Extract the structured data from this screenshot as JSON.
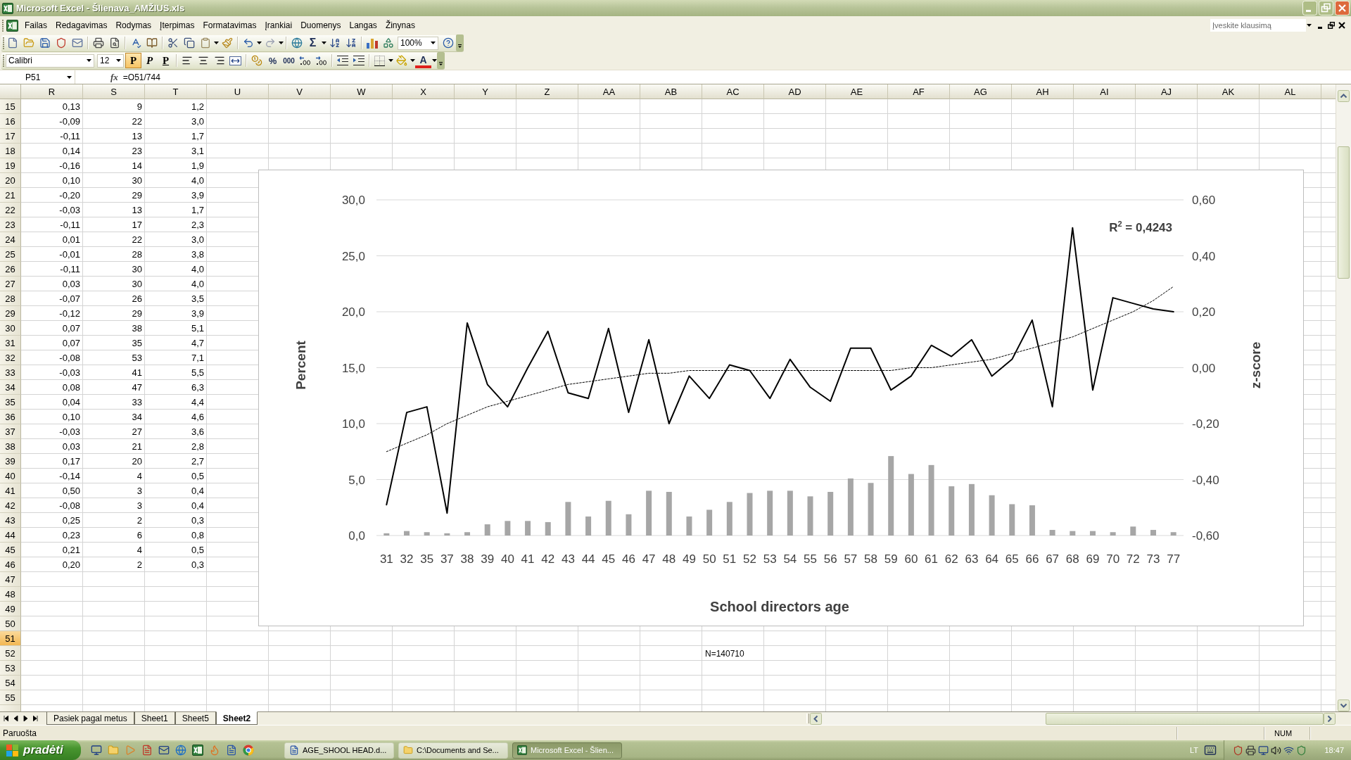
{
  "window": {
    "title": "Microsoft Excel - Šlienava_AMŽIUS.xls"
  },
  "menu": {
    "items": [
      "Failas",
      "Redagavimas",
      "Rodymas",
      "Įterpimas",
      "Formatavimas",
      "Įrankiai",
      "Duomenys",
      "Langas",
      "Žinynas"
    ],
    "help_box": {
      "placeholder": "Įveskite klausimą"
    }
  },
  "standard_toolbar": {
    "autosum": "Σ",
    "zoom": "100%"
  },
  "formatting_toolbar": {
    "font": "Calibri",
    "size": "12",
    "styles": [
      {
        "kind": "bold",
        "label": "P",
        "selected": true
      },
      {
        "kind": "italic",
        "label": "P",
        "selected": false
      },
      {
        "kind": "underline",
        "label": "P",
        "selected": false
      }
    ],
    "percent": "%",
    "thousands": "000",
    "font_color": "A"
  },
  "formula_bar": {
    "name_box": "P51",
    "fx": "fx",
    "formula": "=O51/744"
  },
  "sheet": {
    "columns": [
      {
        "label": "R",
        "selected": false
      },
      {
        "label": "S",
        "selected": false
      },
      {
        "label": "T",
        "selected": false
      },
      {
        "label": "U",
        "selected": false
      },
      {
        "label": "V",
        "selected": false
      },
      {
        "label": "W",
        "selected": false
      },
      {
        "label": "X",
        "selected": false
      },
      {
        "label": "Y",
        "selected": false
      },
      {
        "label": "Z",
        "selected": false
      },
      {
        "label": "AA",
        "selected": false
      },
      {
        "label": "AB",
        "selected": false
      },
      {
        "label": "AC",
        "selected": false
      },
      {
        "label": "AD",
        "selected": false
      },
      {
        "label": "AE",
        "selected": false
      },
      {
        "label": "AF",
        "selected": false
      },
      {
        "label": "AG",
        "selected": false
      },
      {
        "label": "AH",
        "selected": false
      },
      {
        "label": "AI",
        "selected": false
      },
      {
        "label": "AJ",
        "selected": false
      },
      {
        "label": "AK",
        "selected": false
      },
      {
        "label": "AL",
        "selected": false
      }
    ],
    "rows": [
      {
        "label": "15",
        "selected": false,
        "values": [
          "0,13",
          "9",
          "1,2"
        ]
      },
      {
        "label": "16",
        "selected": false,
        "values": [
          "-0,09",
          "22",
          "3,0"
        ]
      },
      {
        "label": "17",
        "selected": false,
        "values": [
          "-0,11",
          "13",
          "1,7"
        ]
      },
      {
        "label": "18",
        "selected": false,
        "values": [
          "0,14",
          "23",
          "3,1"
        ]
      },
      {
        "label": "19",
        "selected": false,
        "values": [
          "-0,16",
          "14",
          "1,9"
        ]
      },
      {
        "label": "20",
        "selected": false,
        "values": [
          "0,10",
          "30",
          "4,0"
        ]
      },
      {
        "label": "21",
        "selected": false,
        "values": [
          "-0,20",
          "29",
          "3,9"
        ]
      },
      {
        "label": "22",
        "selected": false,
        "values": [
          "-0,03",
          "13",
          "1,7"
        ]
      },
      {
        "label": "23",
        "selected": false,
        "values": [
          "-0,11",
          "17",
          "2,3"
        ]
      },
      {
        "label": "24",
        "selected": false,
        "values": [
          "0,01",
          "22",
          "3,0"
        ]
      },
      {
        "label": "25",
        "selected": false,
        "values": [
          "-0,01",
          "28",
          "3,8"
        ]
      },
      {
        "label": "26",
        "selected": false,
        "values": [
          "-0,11",
          "30",
          "4,0"
        ]
      },
      {
        "label": "27",
        "selected": false,
        "values": [
          "0,03",
          "30",
          "4,0"
        ]
      },
      {
        "label": "28",
        "selected": false,
        "values": [
          "-0,07",
          "26",
          "3,5"
        ]
      },
      {
        "label": "29",
        "selected": false,
        "values": [
          "-0,12",
          "29",
          "3,9"
        ]
      },
      {
        "label": "30",
        "selected": false,
        "values": [
          "0,07",
          "38",
          "5,1"
        ]
      },
      {
        "label": "31",
        "selected": false,
        "values": [
          "0,07",
          "35",
          "4,7"
        ]
      },
      {
        "label": "32",
        "selected": false,
        "values": [
          "-0,08",
          "53",
          "7,1"
        ]
      },
      {
        "label": "33",
        "selected": false,
        "values": [
          "-0,03",
          "41",
          "5,5"
        ]
      },
      {
        "label": "34",
        "selected": false,
        "values": [
          "0,08",
          "47",
          "6,3"
        ]
      },
      {
        "label": "35",
        "selected": false,
        "values": [
          "0,04",
          "33",
          "4,4"
        ]
      },
      {
        "label": "36",
        "selected": false,
        "values": [
          "0,10",
          "34",
          "4,6"
        ]
      },
      {
        "label": "37",
        "selected": false,
        "values": [
          "-0,03",
          "27",
          "3,6"
        ]
      },
      {
        "label": "38",
        "selected": false,
        "values": [
          "0,03",
          "21",
          "2,8"
        ]
      },
      {
        "label": "39",
        "selected": false,
        "values": [
          "0,17",
          "20",
          "2,7"
        ]
      },
      {
        "label": "40",
        "selected": false,
        "values": [
          "-0,14",
          "4",
          "0,5"
        ]
      },
      {
        "label": "41",
        "selected": false,
        "values": [
          "0,50",
          "3",
          "0,4"
        ]
      },
      {
        "label": "42",
        "selected": false,
        "values": [
          "-0,08",
          "3",
          "0,4"
        ]
      },
      {
        "label": "43",
        "selected": false,
        "values": [
          "0,25",
          "2",
          "0,3"
        ]
      },
      {
        "label": "44",
        "selected": false,
        "values": [
          "0,23",
          "6",
          "0,8"
        ]
      },
      {
        "label": "45",
        "selected": false,
        "values": [
          "0,21",
          "4",
          "0,5"
        ]
      },
      {
        "label": "46",
        "selected": false,
        "values": [
          "0,20",
          "2",
          "0,3"
        ]
      },
      {
        "label": "47",
        "selected": false
      },
      {
        "label": "48",
        "selected": false
      },
      {
        "label": "49",
        "selected": false
      },
      {
        "label": "50",
        "selected": false
      },
      {
        "label": "51",
        "selected": true
      },
      {
        "label": "52",
        "selected": false,
        "note": "N=140710"
      },
      {
        "label": "53",
        "selected": false
      },
      {
        "label": "54",
        "selected": false
      },
      {
        "label": "55",
        "selected": false
      }
    ]
  },
  "chart": {
    "chart_data": {
      "type": "bar",
      "grid": true,
      "xlabel": "School directors age",
      "ylabel": "Percent",
      "y2label": "z-score",
      "categories": [
        "31",
        "32",
        "35",
        "37",
        "38",
        "39",
        "40",
        "41",
        "42",
        "43",
        "44",
        "45",
        "46",
        "47",
        "48",
        "49",
        "50",
        "51",
        "52",
        "53",
        "54",
        "55",
        "56",
        "57",
        "58",
        "59",
        "60",
        "61",
        "62",
        "63",
        "64",
        "65",
        "66",
        "67",
        "68",
        "69",
        "70",
        "72",
        "73",
        "77"
      ],
      "ylim": [
        0,
        30
      ],
      "y2lim": [
        -0.6,
        0.6
      ],
      "yticks": [
        {
          "value": 0,
          "label": "0,0"
        },
        {
          "value": 5,
          "label": "5,0"
        },
        {
          "value": 10,
          "label": "10,0"
        },
        {
          "value": 15,
          "label": "15,0"
        },
        {
          "value": 20,
          "label": "20,0"
        },
        {
          "value": 25,
          "label": "25,0"
        },
        {
          "value": 30,
          "label": "30,0"
        }
      ],
      "y2ticks": [
        {
          "value": -0.6,
          "label": "-0,60"
        },
        {
          "value": -0.4,
          "label": "-0,40"
        },
        {
          "value": -0.2,
          "label": "-0,20"
        },
        {
          "value": 0,
          "label": "0,00"
        },
        {
          "value": 0.2,
          "label": "0,20"
        },
        {
          "value": 0.4,
          "label": "0,40"
        },
        {
          "value": 0.6,
          "label": "0,60"
        }
      ],
      "series": [
        {
          "type": "bar",
          "color": "#a6a6a6",
          "values": [
            0.2,
            0.4,
            0.3,
            0.2,
            0.3,
            1.0,
            1.3,
            1.3,
            1.2,
            3.0,
            1.7,
            3.1,
            1.9,
            4.0,
            3.9,
            1.7,
            2.3,
            3.0,
            3.8,
            4.0,
            4.0,
            3.5,
            3.9,
            5.1,
            4.7,
            7.1,
            5.5,
            6.3,
            4.4,
            4.6,
            3.6,
            2.8,
            2.7,
            0.5,
            0.4,
            0.4,
            0.3,
            0.8,
            0.5,
            0.3
          ]
        },
        {
          "type": "line",
          "axis": "y2",
          "color": "#000000",
          "values": [
            -0.49,
            -0.16,
            -0.14,
            -0.52,
            0.16,
            -0.06,
            -0.14,
            0.0,
            0.13,
            -0.09,
            -0.11,
            0.14,
            -0.16,
            0.1,
            -0.2,
            -0.03,
            -0.11,
            0.01,
            -0.01,
            -0.11,
            0.03,
            -0.07,
            -0.12,
            0.07,
            0.07,
            -0.08,
            -0.03,
            0.08,
            0.04,
            0.1,
            -0.03,
            0.03,
            0.17,
            -0.14,
            0.5,
            -0.08,
            0.25,
            0.23,
            0.21,
            0.2
          ]
        },
        {
          "type": "line",
          "axis": "y2",
          "line_style": "dotted",
          "color": "#000000",
          "values": [
            -0.3,
            -0.27,
            -0.24,
            -0.2,
            -0.17,
            -0.14,
            -0.12,
            -0.1,
            -0.08,
            -0.06,
            -0.05,
            -0.04,
            -0.03,
            -0.02,
            -0.02,
            -0.01,
            -0.01,
            -0.01,
            -0.01,
            -0.01,
            -0.01,
            -0.01,
            -0.01,
            -0.01,
            -0.01,
            -0.01,
            0.0,
            0.0,
            0.01,
            0.02,
            0.03,
            0.05,
            0.07,
            0.09,
            0.11,
            0.14,
            0.17,
            0.2,
            0.24,
            0.29
          ]
        }
      ],
      "annotations": [
        {
          "text": "R$^{2}$ = 0,4243"
        }
      ]
    }
  },
  "sheet_tabs": [
    {
      "label": "Pasiek pagal metus",
      "selected": false
    },
    {
      "label": "Sheet1",
      "selected": false
    },
    {
      "label": "Sheet5",
      "selected": false
    },
    {
      "label": "Sheet2",
      "selected": true
    }
  ],
  "status_bar": {
    "text": "Paruošta",
    "indicator": "NUM"
  },
  "taskbar": {
    "start": "pradėti",
    "tasks": [
      {
        "kind": "word",
        "label": "AGE_SHOOL HEAD.d...",
        "selected": false
      },
      {
        "kind": "folder",
        "label": "C:\\Documents and Se...",
        "selected": false
      },
      {
        "kind": "excel",
        "label": "Microsoft Excel - Šlien...",
        "selected": true
      }
    ],
    "language": "LT",
    "clock": "18:47"
  }
}
